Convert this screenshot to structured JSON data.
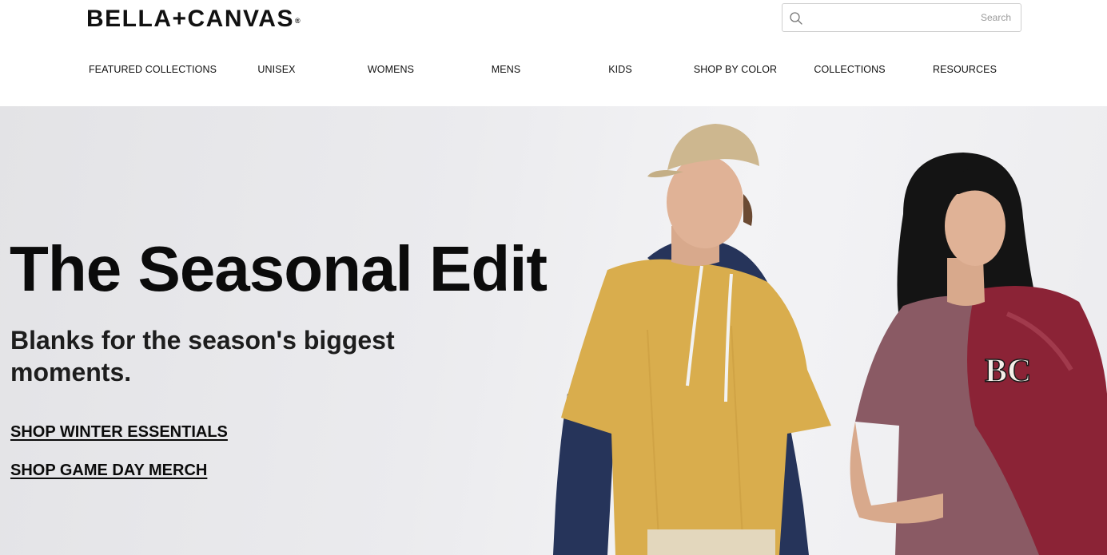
{
  "header": {
    "logo": "BELLA+CANVAS",
    "logo_mark": "®",
    "search": {
      "placeholder": "Search",
      "value": ""
    }
  },
  "nav": {
    "items": [
      {
        "label": "FEATURED COLLECTIONS"
      },
      {
        "label": "UNISEX"
      },
      {
        "label": "WOMENS"
      },
      {
        "label": "MENS"
      },
      {
        "label": "KIDS"
      },
      {
        "label": "SHOP BY COLOR"
      },
      {
        "label": "COLLECTIONS"
      },
      {
        "label": "RESOURCES"
      }
    ]
  },
  "hero": {
    "title": "The Seasonal Edit",
    "subtitle": "Blanks for the season's biggest moments.",
    "links": [
      {
        "label": "SHOP WINTER ESSENTIALS"
      },
      {
        "label": "SHOP GAME DAY MERCH"
      }
    ],
    "jacket_letters": "BC"
  },
  "colors": {
    "hero_background": "#e9e9ec",
    "cap": "#cdb78f",
    "mustard_tee": "#d9ad4d",
    "navy_hoodie": "#26345a",
    "mauve_tee": "#8a5a64",
    "maroon_jacket": "#8b2336",
    "hair": "#141414",
    "skin": "#d8a98c"
  },
  "icons": {
    "search": "search-icon"
  }
}
